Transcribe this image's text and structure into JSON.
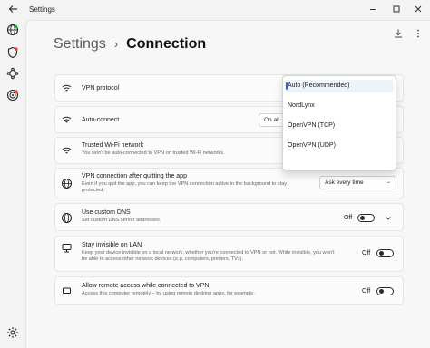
{
  "window": {
    "title": "Settings"
  },
  "breadcrumb": {
    "parent": "Settings",
    "separator": "›",
    "current": "Connection"
  },
  "settings": {
    "vpn_protocol": {
      "title": "VPN protocol",
      "value": "Auto (Recommended)",
      "options": [
        "Auto (Recommended)",
        "NordLynx",
        "OpenVPN (TCP)",
        "OpenVPN (UDP)"
      ]
    },
    "auto_connect": {
      "title": "Auto-connect",
      "value": "On all"
    },
    "trusted_wifi": {
      "title": "Trusted Wi-Fi network",
      "description": "You won't be auto-connected to VPN on trusted Wi-Fi networks."
    },
    "after_quit": {
      "title": "VPN connection after quitting the app",
      "description": "Even if you quit the app, you can keep the VPN connection active in the background to stay protected.",
      "value": "Ask every time"
    },
    "custom_dns": {
      "title": "Use custom DNS",
      "description": "Set custom DNS server addresses.",
      "state": "Off"
    },
    "invisible_lan": {
      "title": "Stay invisible on LAN",
      "description": "Keep your device invisible on a local network, whether you're connected to VPN or not. While invisible, you won't be able to access other network devices (e.g. computers, printers, TVs).",
      "state": "Off"
    },
    "remote_access": {
      "title": "Allow remote access while connected to VPN",
      "description": "Access this computer remotely – by using remote desktop apps, for example.",
      "state": "Off"
    }
  },
  "colors": {
    "accent": "#2a63d8",
    "vpn_icon_red": "#e0413a"
  }
}
